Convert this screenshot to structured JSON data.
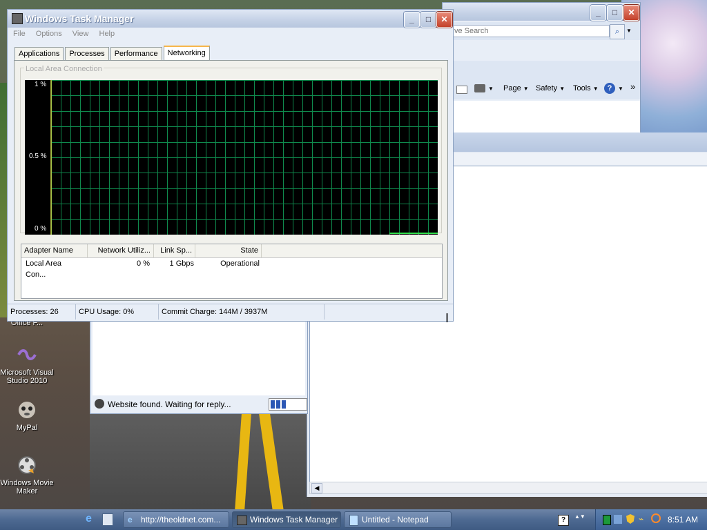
{
  "desktop": {
    "icons": [
      {
        "label": "Office F...",
        "icon": "office-icon"
      },
      {
        "label": "Microsoft Visual Studio 2010",
        "icon": "visual-studio-icon"
      },
      {
        "label": "MyPal",
        "icon": "mypal-icon"
      },
      {
        "label": "Windows Movie Maker",
        "icon": "movie-maker-icon"
      }
    ]
  },
  "browser": {
    "search_placeholder": "ve Search",
    "toolbar": {
      "page": "Page",
      "safety": "Safety",
      "tools": "Tools",
      "overflow": "»"
    },
    "status_text": "Website found. Waiting for reply..."
  },
  "task_manager": {
    "title": "Windows Task Manager",
    "menu": [
      "File",
      "Options",
      "View",
      "Help"
    ],
    "tabs": [
      "Applications",
      "Processes",
      "Performance",
      "Networking"
    ],
    "active_tab": "Networking",
    "group_title": "Local Area Connection",
    "graph": {
      "y_top": "1 %",
      "y_mid": "0.5 %",
      "y_bottom": "0 %",
      "grid_color": "#0f8a4d",
      "line_color": "#2fdd4a"
    },
    "columns": [
      "Adapter Name",
      "Network Utiliz...",
      "Link Sp...",
      "State"
    ],
    "rows": [
      {
        "name": "Local Area Con...",
        "util": "0 %",
        "speed": "1 Gbps",
        "state": "Operational"
      }
    ],
    "status": {
      "processes": "Processes: 26",
      "cpu": "CPU Usage: 0%",
      "commit": "Commit Charge: 144M / 3937M"
    }
  },
  "taskbar": {
    "buttons": [
      {
        "label": "http://theoldnet.com...",
        "icon": "ie-icon"
      },
      {
        "label": "Windows Task Manager",
        "icon": "task-manager-icon"
      },
      {
        "label": "Untitled - Notepad",
        "icon": "notepad-icon"
      }
    ],
    "clock": "8:51 AM"
  }
}
